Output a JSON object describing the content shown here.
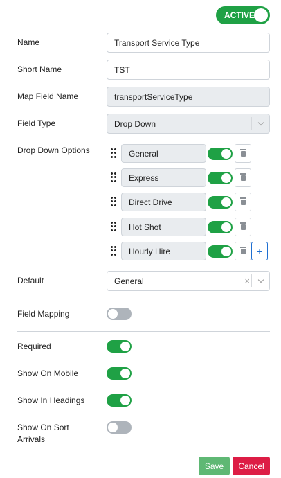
{
  "status_toggle": {
    "label": "ACTIVE",
    "on": true
  },
  "fields": {
    "name": {
      "label": "Name",
      "value": "Transport Service Type"
    },
    "short_name": {
      "label": "Short Name",
      "value": "TST"
    },
    "map_field_name": {
      "label": "Map Field Name",
      "value": "transportServiceType"
    },
    "field_type": {
      "label": "Field Type",
      "value": "Drop Down"
    }
  },
  "dropdown_options": {
    "label": "Drop Down Options",
    "items": [
      {
        "value": "General",
        "enabled": true
      },
      {
        "value": "Express",
        "enabled": true
      },
      {
        "value": "Direct Drive",
        "enabled": true
      },
      {
        "value": "Hot Shot",
        "enabled": true
      },
      {
        "value": "Hourly Hire",
        "enabled": true
      }
    ],
    "add_label": "+"
  },
  "default": {
    "label": "Default",
    "value": "General",
    "clear_label": "×"
  },
  "toggles": {
    "field_mapping": {
      "label": "Field Mapping",
      "on": false
    },
    "required": {
      "label": "Required",
      "on": true
    },
    "show_on_mobile": {
      "label": "Show On Mobile",
      "on": true
    },
    "show_in_headings": {
      "label": "Show In Headings",
      "on": true
    },
    "show_on_sort_arrivals": {
      "label": "Show On Sort Arrivals",
      "on": false
    }
  },
  "actions": {
    "save_label": "Save",
    "cancel_label": "Cancel"
  },
  "colors": {
    "accent_green": "#1fa145",
    "toggle_off": "#aeb4bb",
    "cancel_red": "#dd1d45",
    "save_green": "#5fb874",
    "add_blue": "#1f6fd1"
  }
}
